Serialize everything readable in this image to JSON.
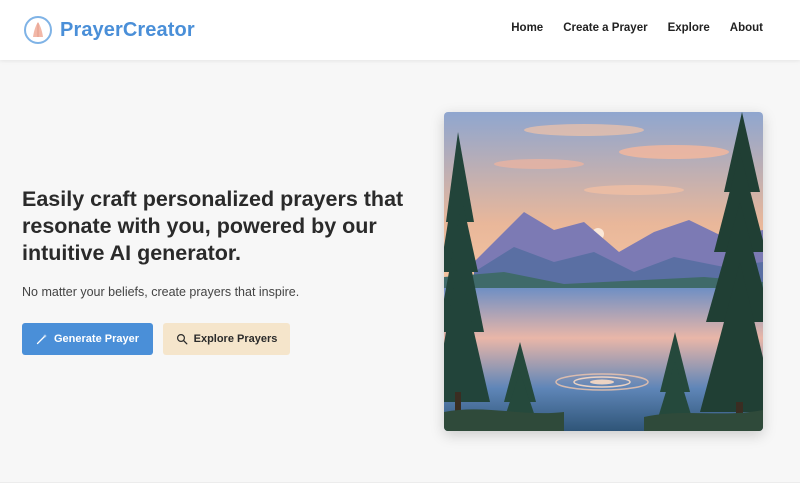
{
  "brand": {
    "name": "PrayerCreator",
    "logo_icon": "praying-hands-icon"
  },
  "nav": {
    "items": [
      {
        "label": "Home"
      },
      {
        "label": "Create a Prayer"
      },
      {
        "label": "Explore"
      },
      {
        "label": "About"
      }
    ]
  },
  "hero": {
    "headline": "Easily craft personalized prayers that resonate with you, powered by our intuitive AI generator.",
    "subtext": "No matter your beliefs, create prayers that inspire.",
    "primary_button": {
      "label": "Generate Prayer",
      "icon": "magic-wand-icon"
    },
    "secondary_button": {
      "label": "Explore Prayers",
      "icon": "search-icon"
    },
    "image": {
      "subject": "mountain-lake-sunset-painting"
    }
  },
  "colors": {
    "brand": "#4a8fd8",
    "primary_button": "#4a8fd8",
    "secondary_button": "#f5e5cb",
    "background": "#f7f7f7"
  }
}
